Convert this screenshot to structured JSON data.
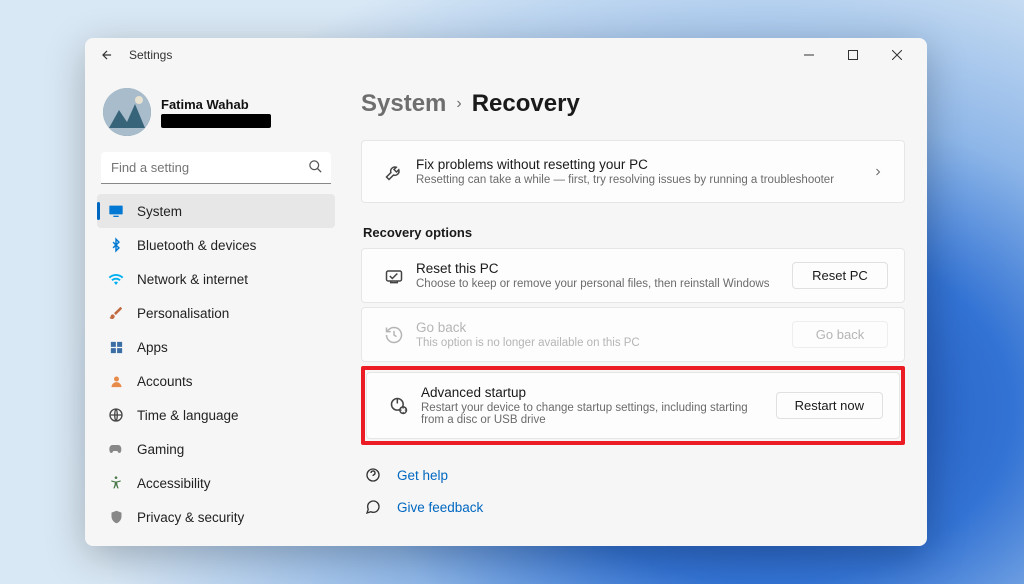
{
  "titlebar": {
    "title": "Settings"
  },
  "profile": {
    "name": "Fatima Wahab"
  },
  "search": {
    "placeholder": "Find a setting"
  },
  "nav": {
    "items": [
      {
        "label": "System",
        "icon": "monitor",
        "active": true,
        "color": "#0078d4"
      },
      {
        "label": "Bluetooth & devices",
        "icon": "bluetooth",
        "color": "#0078d4"
      },
      {
        "label": "Network & internet",
        "icon": "wifi",
        "color": "#00b0f0"
      },
      {
        "label": "Personalisation",
        "icon": "brush",
        "color": "#c26a3f"
      },
      {
        "label": "Apps",
        "icon": "apps",
        "color": "#3a6ea5"
      },
      {
        "label": "Accounts",
        "icon": "person",
        "color": "#e88b4a"
      },
      {
        "label": "Time & language",
        "icon": "clock-lang",
        "color": "#444"
      },
      {
        "label": "Gaming",
        "icon": "gaming",
        "color": "#888"
      },
      {
        "label": "Accessibility",
        "icon": "accessibility",
        "color": "#4a7a4a"
      },
      {
        "label": "Privacy & security",
        "icon": "shield",
        "color": "#888"
      }
    ]
  },
  "breadcrumb": {
    "parent": "System",
    "current": "Recovery"
  },
  "troubleshoot": {
    "title": "Fix problems without resetting your PC",
    "sub": "Resetting can take a while — first, try resolving issues by running a troubleshooter"
  },
  "section_title": "Recovery options",
  "reset": {
    "title": "Reset this PC",
    "sub": "Choose to keep or remove your personal files, then reinstall Windows",
    "button": "Reset PC"
  },
  "goback": {
    "title": "Go back",
    "sub": "This option is no longer available on this PC",
    "button": "Go back"
  },
  "advanced": {
    "title": "Advanced startup",
    "sub": "Restart your device to change startup settings, including starting from a disc or USB drive",
    "button": "Restart now"
  },
  "help": {
    "get_help": "Get help",
    "give_feedback": "Give feedback"
  }
}
